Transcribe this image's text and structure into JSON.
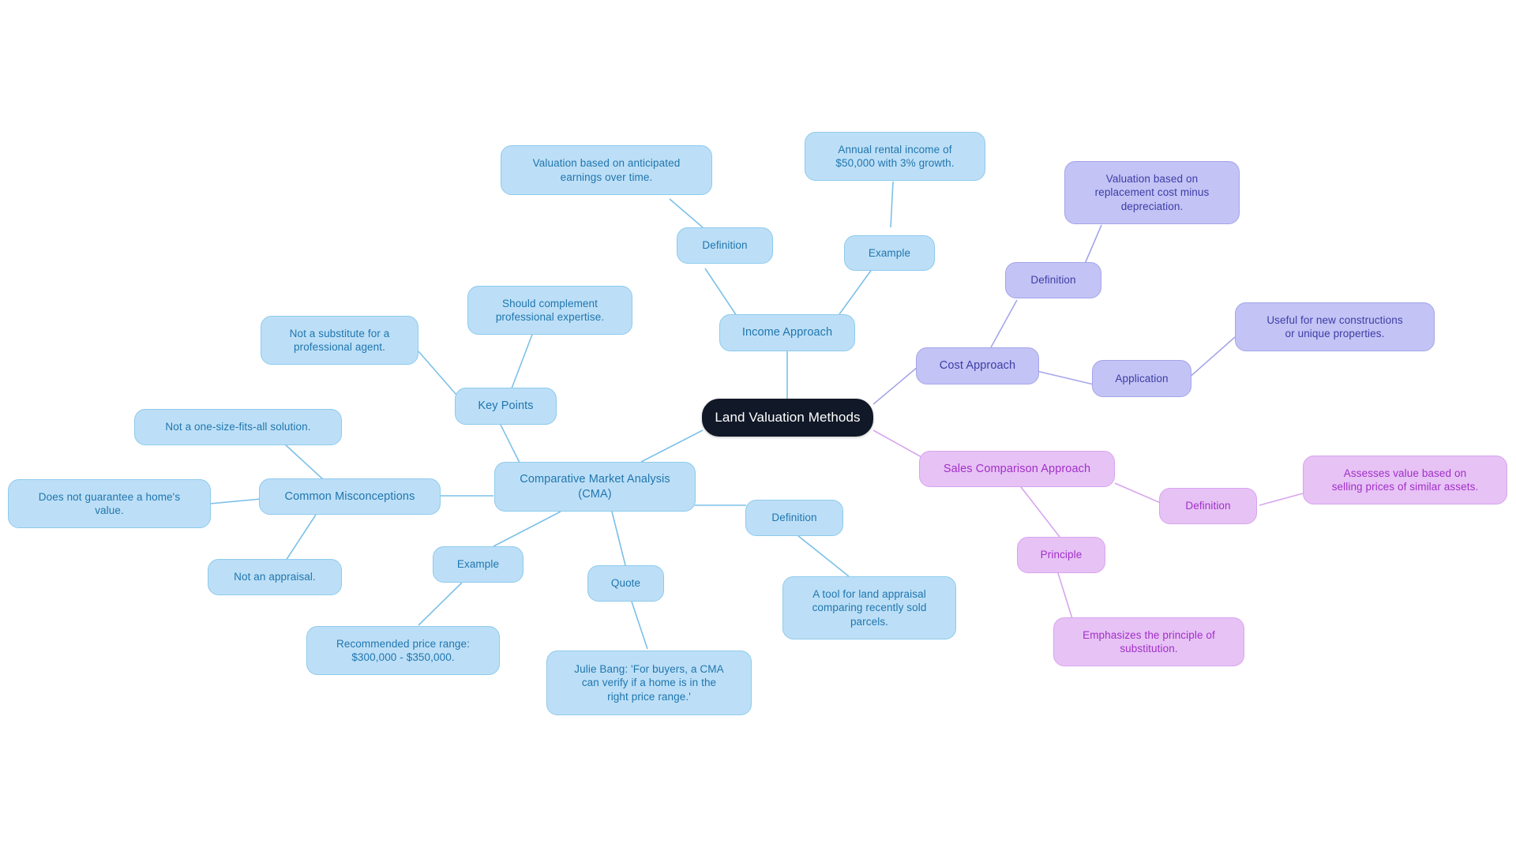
{
  "diagram": {
    "type": "mind-map",
    "title": "Land Valuation Methods",
    "background": "#ffffff",
    "palettes": {
      "root_bg": "#111827",
      "root_text": "#ffffff",
      "blue_bg": "#a8d8f5",
      "blue_text": "#1b6ca8",
      "purple_bg": "#c3c3f5",
      "purple_text": "#3d3da8",
      "pink_bg": "#e7c2f5",
      "pink_text": "#a030c8"
    }
  },
  "nodes": {
    "root": "Land Valuation Methods",
    "income_approach": "Income Approach",
    "income_definition": "Definition",
    "income_definition_detail": "Valuation based on anticipated\nearnings over time.",
    "income_example": "Example",
    "income_example_detail": "Annual rental income of\n$50,000 with 3% growth.",
    "cost_approach": "Cost Approach",
    "cost_definition": "Definition",
    "cost_definition_detail": "Valuation based on\nreplacement cost minus\ndepreciation.",
    "cost_application": "Application",
    "cost_application_detail": "Useful for new constructions\nor unique properties.",
    "sales_comparison": "Sales Comparison Approach",
    "sales_definition": "Definition",
    "sales_definition_detail": "Assesses value based on\nselling prices of similar assets.",
    "sales_principle": "Principle",
    "sales_principle_detail": "Emphasizes the principle of\nsubstitution.",
    "cma": "Comparative Market Analysis\n(CMA)",
    "cma_definition": "Definition",
    "cma_definition_detail": "A tool for land appraisal\ncomparing recently sold\nparcels.",
    "cma_quote": "Quote",
    "cma_quote_detail": "Julie Bang: 'For buyers, a CMA\ncan verify if a home is in the\nright price range.'",
    "cma_example": "Example",
    "cma_example_detail": "Recommended price range:\n$300,000 - $350,000.",
    "key_points": "Key Points",
    "key_point_1": "Not a substitute for a\nprofessional agent.",
    "key_point_2": "Should complement\nprofessional expertise.",
    "common_misconceptions": "Common Misconceptions",
    "misconception_1": "Not a one-size-fits-all solution.",
    "misconception_2": "Does not guarantee a home's\nvalue.",
    "misconception_3": "Not an appraisal."
  }
}
